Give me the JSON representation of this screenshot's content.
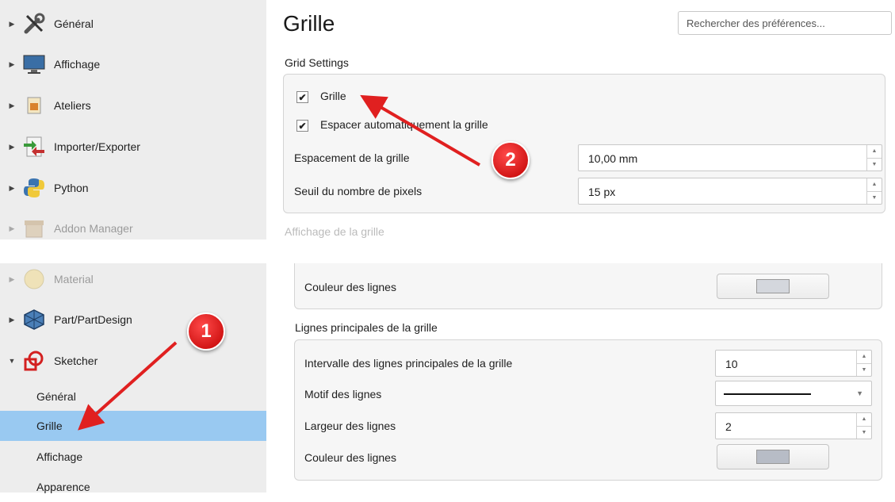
{
  "sidebar": {
    "items": [
      {
        "label": "Général",
        "icon": "tools-icon"
      },
      {
        "label": "Affichage",
        "icon": "monitor-icon"
      },
      {
        "label": "Ateliers",
        "icon": "workbench-icon"
      },
      {
        "label": "Importer/Exporter",
        "icon": "import-export-icon"
      },
      {
        "label": "Python",
        "icon": "python-icon"
      },
      {
        "label": "Addon Manager",
        "icon": "addon-icon"
      },
      {
        "label": "Material",
        "icon": "material-icon"
      },
      {
        "label": "Part/PartDesign",
        "icon": "part-icon"
      },
      {
        "label": "Sketcher",
        "icon": "sketcher-icon"
      }
    ],
    "sub_items": [
      {
        "label": "Général"
      },
      {
        "label": "Grille",
        "selected": true
      },
      {
        "label": "Affichage"
      },
      {
        "label": "Apparence"
      }
    ]
  },
  "page": {
    "title": "Grille",
    "search_placeholder": "Rechercher des préférences..."
  },
  "grid_settings": {
    "header": "Grid Settings",
    "grid_checkbox": "Grille",
    "auto_spacing_checkbox": "Espacer automatiquement la grille",
    "spacing_label": "Espacement de la grille",
    "spacing_value": "10,00 mm",
    "pixel_threshold_label": "Seuil du nombre de pixels",
    "pixel_threshold_value": "15 px"
  },
  "grid_display": {
    "header": "Affichage de la grille",
    "line_color_label": "Couleur des lignes",
    "line_color": "#d4d7dd"
  },
  "major_lines": {
    "header": "Lignes principales de la grille",
    "interval_label": "Intervalle des lignes principales de la grille",
    "interval_value": "10",
    "pattern_label": "Motif des lignes",
    "width_label": "Largeur des lignes",
    "width_value": "2",
    "color_label": "Couleur des lignes",
    "line_color": "#b7bcc6"
  },
  "annotations": {
    "badge_1": "1",
    "badge_2": "2",
    "color": "#e02020"
  }
}
